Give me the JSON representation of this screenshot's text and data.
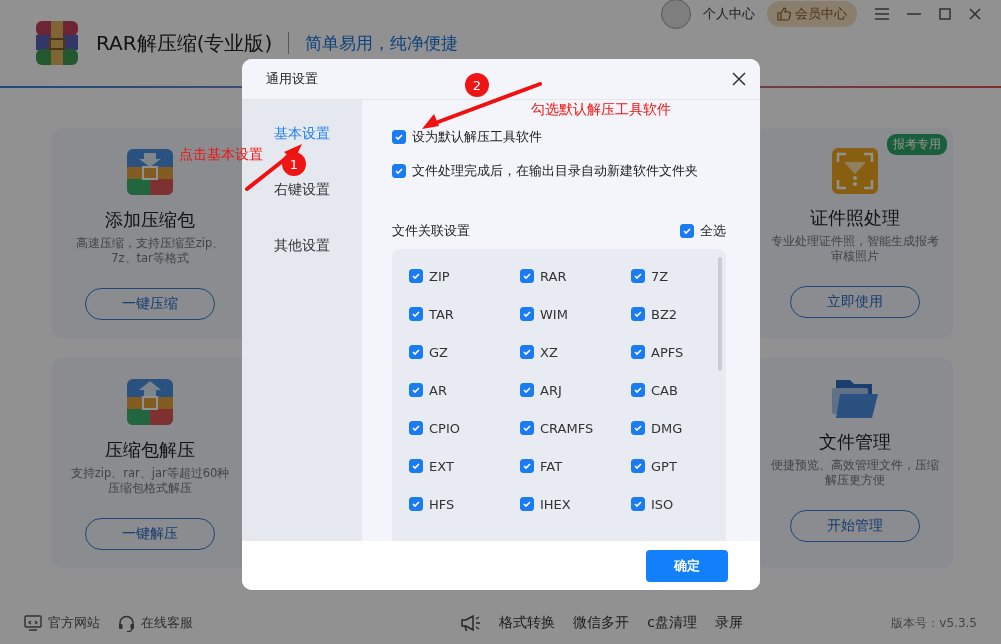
{
  "app": {
    "title": "RAR解压缩(专业版)",
    "slogan": "简单易用，纯净便捷",
    "user_label": "个人中心",
    "vip_label": "会员中心"
  },
  "card_rows": [
    {
      "left": {
        "kind": "compress",
        "title": "添加压缩包",
        "desc": "高速压缩，支持压缩至zip、7z、tar等格式",
        "button": "一键压缩"
      },
      "right": {
        "kind": "photo",
        "badge": "报考专用",
        "title": "证件照处理",
        "desc": "专业处理证件照，智能生成报考审核照片",
        "button": "立即使用"
      }
    },
    {
      "left": {
        "kind": "extract",
        "title": "压缩包解压",
        "desc": "支持zip、rar、jar等超过60种压缩包格式解压",
        "button": "一键解压"
      },
      "right": {
        "kind": "folder",
        "title": "文件管理",
        "desc": "便捷预览、高效管理文件，压缩解压更方便",
        "button": "开始管理"
      }
    }
  ],
  "footer": {
    "links": [
      {
        "kind": "monitor",
        "label": "官方网站"
      },
      {
        "kind": "headset",
        "label": "在线客服"
      }
    ],
    "tools": [
      "格式转换",
      "微信多开",
      "c盘清理",
      "录屏"
    ],
    "version": "版本号：v5.3.5"
  },
  "dialog": {
    "title": "通用设置",
    "nav": [
      {
        "label": "基本设置",
        "selected": true
      },
      {
        "label": "右键设置",
        "selected": false
      },
      {
        "label": "其他设置",
        "selected": false
      }
    ],
    "options": [
      {
        "label": "设为默认解压工具软件",
        "checked": true
      },
      {
        "label": "文件处理完成后，在输出目录自动新建软件文件夹",
        "checked": true
      }
    ],
    "association": {
      "title": "文件关联设置",
      "select_all": {
        "label": "全选",
        "checked": true
      },
      "formats": [
        {
          "label": "ZIP",
          "checked": true
        },
        {
          "label": "RAR",
          "checked": true
        },
        {
          "label": "7Z",
          "checked": true
        },
        {
          "label": "TAR",
          "checked": true
        },
        {
          "label": "WIM",
          "checked": true
        },
        {
          "label": "BZ2",
          "checked": true
        },
        {
          "label": "GZ",
          "checked": true
        },
        {
          "label": "XZ",
          "checked": true
        },
        {
          "label": "APFS",
          "checked": true
        },
        {
          "label": "AR",
          "checked": true
        },
        {
          "label": "ARJ",
          "checked": true
        },
        {
          "label": "CAB",
          "checked": true
        },
        {
          "label": "CPIO",
          "checked": true
        },
        {
          "label": "CRAMFS",
          "checked": true
        },
        {
          "label": "DMG",
          "checked": true
        },
        {
          "label": "EXT",
          "checked": true
        },
        {
          "label": "FAT",
          "checked": true
        },
        {
          "label": "GPT",
          "checked": true
        },
        {
          "label": "HFS",
          "checked": true
        },
        {
          "label": "IHEX",
          "checked": true
        },
        {
          "label": "ISO",
          "checked": true
        }
      ]
    },
    "confirm": "确定"
  },
  "annotations": [
    {
      "number": "1",
      "text": "点击基本设置"
    },
    {
      "number": "2",
      "text": "勾选默认解压工具软件"
    }
  ]
}
